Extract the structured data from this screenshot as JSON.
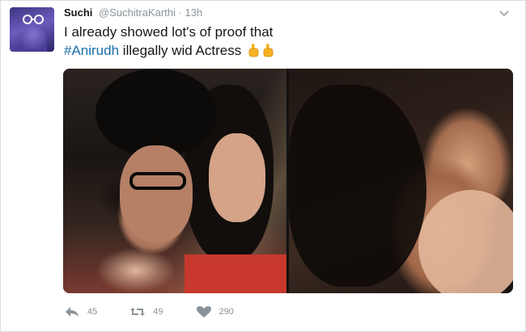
{
  "tweet": {
    "author_name": "Suchi",
    "author_handle": "@SuchitraKarthi",
    "separator": "·",
    "timestamp": "13h",
    "text_line1": "I already showed lot's of proof that",
    "hashtag": "#Anirudh",
    "text_line2_rest": " illegally wid Actress",
    "emoji": [
      "pointing-hand-emoji",
      "pointing-hand-emoji"
    ]
  },
  "media": {
    "images": [
      {
        "icon": "selfie-photo"
      },
      {
        "icon": "kiss-photo"
      }
    ]
  },
  "actions": {
    "reply": {
      "icon": "reply-icon",
      "count": "45"
    },
    "retweet": {
      "icon": "retweet-icon",
      "count": "49"
    },
    "like": {
      "icon": "heart-icon",
      "count": "290"
    }
  },
  "colors": {
    "hashtag": "#1b6fa8",
    "muted": "#8a9399",
    "text": "#14171a",
    "emoji": "#f5b323"
  }
}
